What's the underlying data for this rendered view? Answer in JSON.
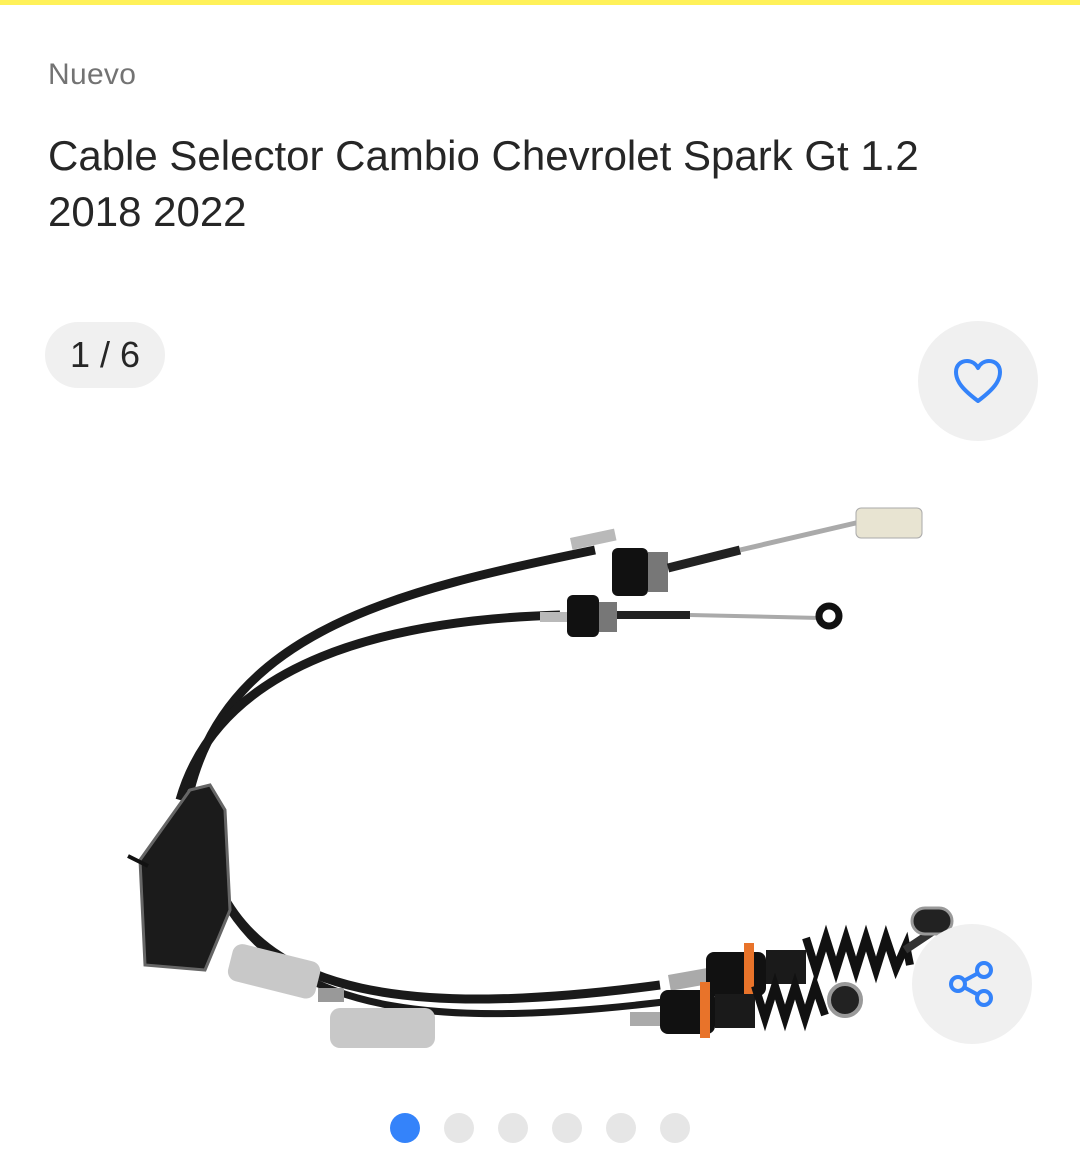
{
  "item": {
    "condition": "Nuevo",
    "title": "Cable Selector Cambio Chevrolet Spark Gt 1.2 2018 2022"
  },
  "gallery": {
    "counter": "1 / 6",
    "current": 1,
    "total": 6,
    "image_subject": "gear-shift-cable",
    "favorite_icon": "heart-icon",
    "share_icon": "share-icon"
  },
  "colors": {
    "brand_yellow": "#fff159",
    "accent_blue": "#3483fa",
    "text_primary": "#262626",
    "text_secondary": "#737373",
    "button_bg": "#f0f0f0",
    "dot_inactive": "#e6e6e6"
  }
}
